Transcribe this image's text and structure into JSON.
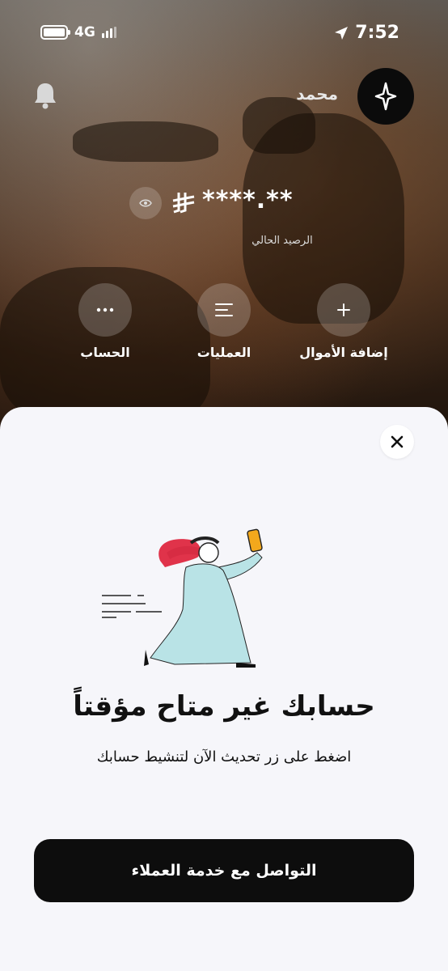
{
  "status_bar": {
    "network": "4G",
    "time": "7:52"
  },
  "header": {
    "user_name": "محمد"
  },
  "balance": {
    "value": "****.**",
    "label": "الرصيد الحالي"
  },
  "actions": [
    {
      "label": "إضافة الأموال",
      "icon": "plus-icon"
    },
    {
      "label": "العمليات",
      "icon": "list-icon"
    },
    {
      "label": "الحساب",
      "icon": "more-dots-icon"
    }
  ],
  "sheet": {
    "title": "حسابك غير متاح مؤقتاً",
    "subtitle": "اضغط على زر تحديث الآن لتنشيط حسابك",
    "cta_label": "التواصل مع خدمة العملاء"
  }
}
